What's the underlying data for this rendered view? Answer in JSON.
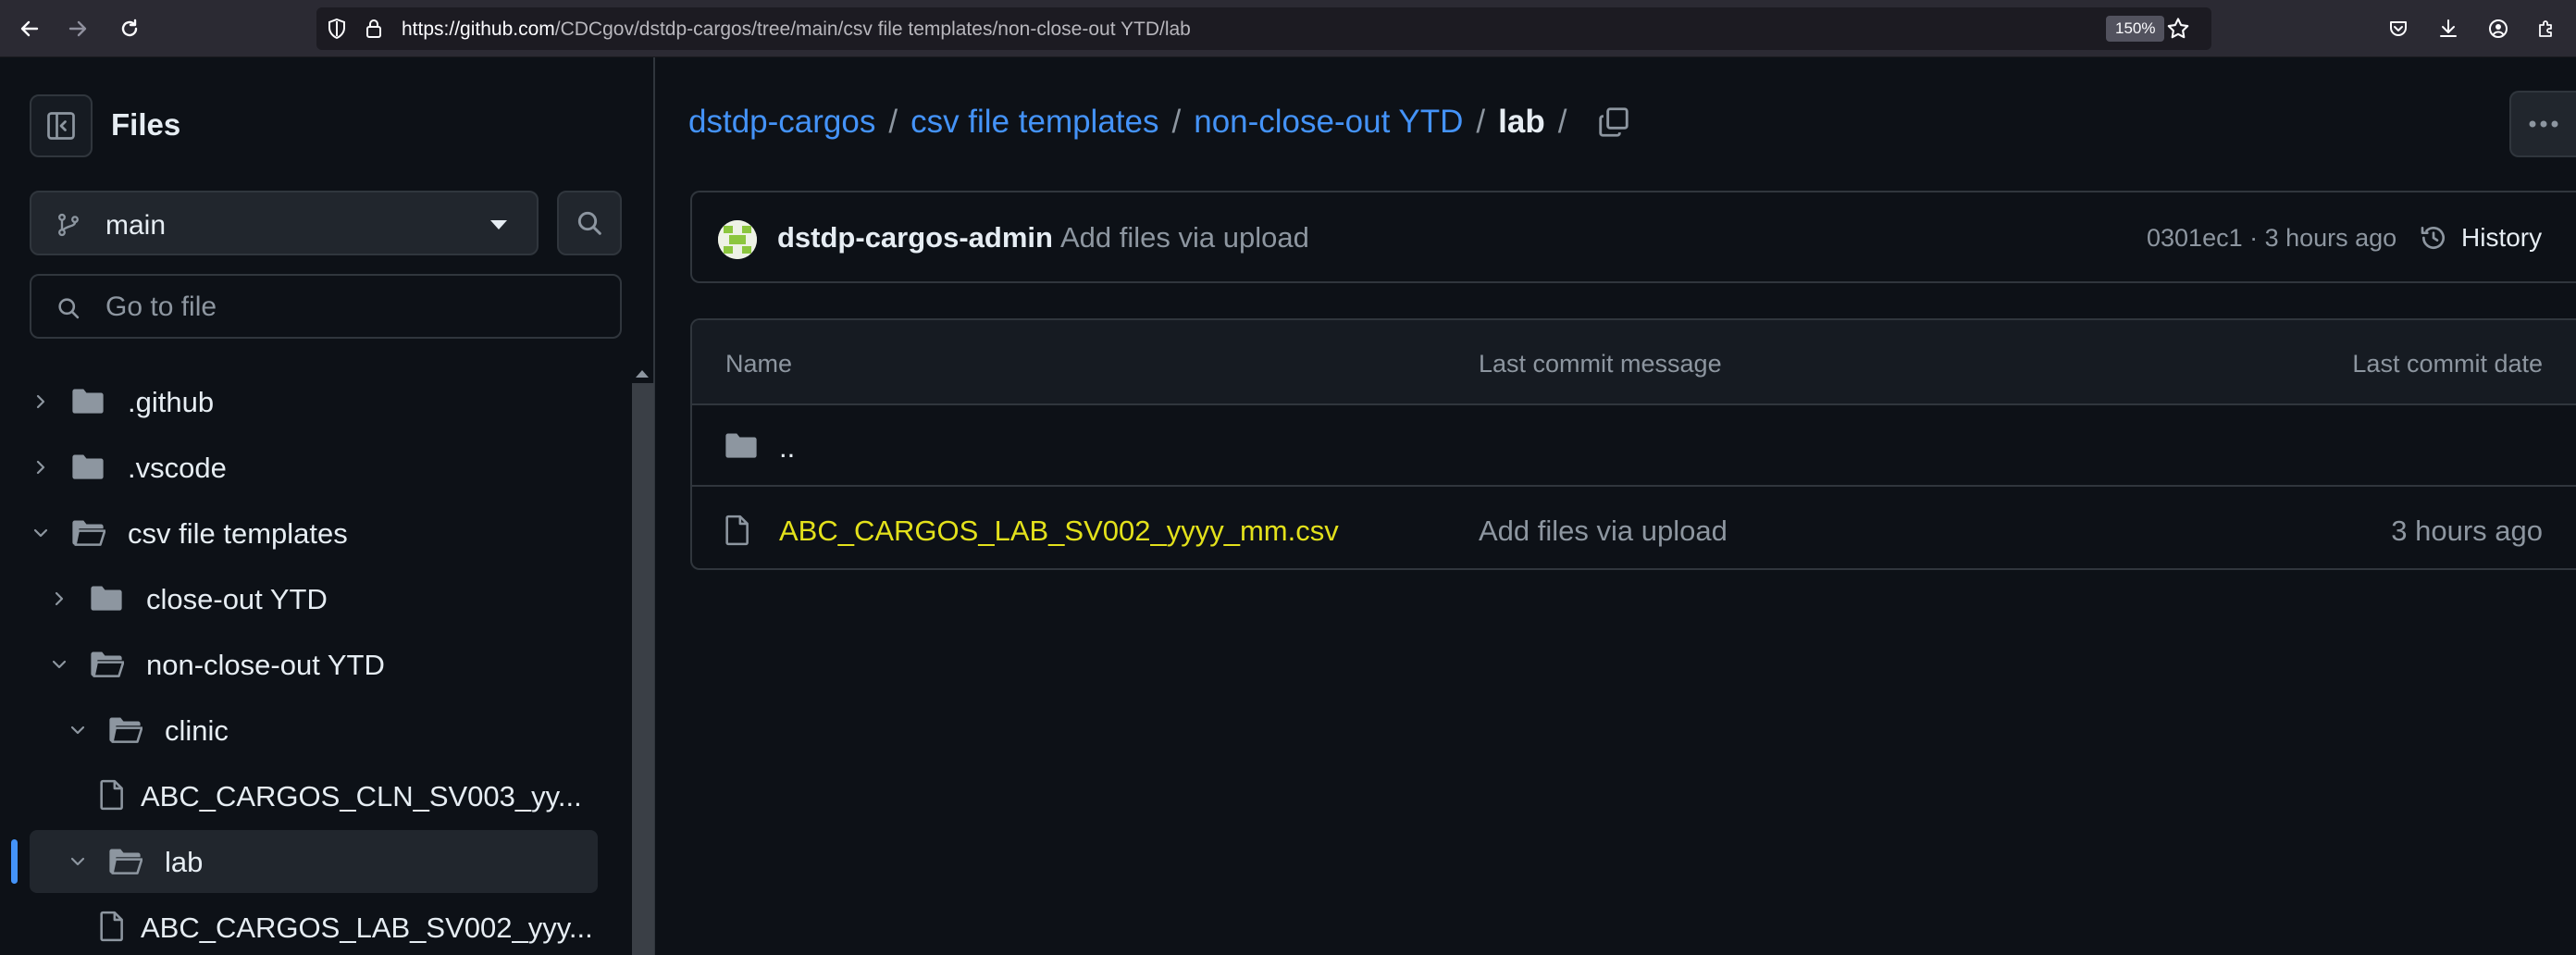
{
  "browser": {
    "url_host": "https://github.com",
    "url_path": "/CDCgov/dstdp-cargos/tree/main/csv file templates/non-close-out YTD/lab",
    "zoom": "150%"
  },
  "sidebar": {
    "title": "Files",
    "branch": "main",
    "goto_placeholder": "Go to file",
    "tree": [
      {
        "label": ".github",
        "type": "folder",
        "expanded": false,
        "depth": 0
      },
      {
        "label": ".vscode",
        "type": "folder",
        "expanded": false,
        "depth": 0
      },
      {
        "label": "csv file templates",
        "type": "folder",
        "expanded": true,
        "depth": 0
      },
      {
        "label": "close-out YTD",
        "type": "folder",
        "expanded": false,
        "depth": 1
      },
      {
        "label": "non-close-out YTD",
        "type": "folder",
        "expanded": true,
        "depth": 1
      },
      {
        "label": "clinic",
        "type": "folder",
        "expanded": true,
        "depth": 2
      },
      {
        "label": "ABC_CARGOS_CLN_SV003_yy...",
        "type": "file",
        "depth": 3
      },
      {
        "label": "lab",
        "type": "folder",
        "expanded": true,
        "depth": 2,
        "active": true
      },
      {
        "label": "ABC_CARGOS_LAB_SV002_yyy...",
        "type": "file",
        "depth": 3
      }
    ]
  },
  "breadcrumb": {
    "repo": "dstdp-cargos",
    "crumbs": [
      "csv file templates",
      "non-close-out YTD"
    ],
    "current": "lab",
    "separator": "/"
  },
  "commit": {
    "author": "dstdp-cargos-admin",
    "message": "Add files via upload",
    "meta": "0301ec1 · 3 hours ago",
    "history_label": "History"
  },
  "table": {
    "headers": {
      "name": "Name",
      "message": "Last commit message",
      "date": "Last commit date"
    },
    "parent_label": "..",
    "rows": [
      {
        "name": "ABC_CARGOS_LAB_SV002_yyyy_mm.csv",
        "message": "Add files via upload",
        "date": "3 hours ago"
      }
    ]
  },
  "colors": {
    "link": "#4493f8",
    "highlight_file": "#e3e11b",
    "background": "#0d1117",
    "border": "#30363d"
  }
}
